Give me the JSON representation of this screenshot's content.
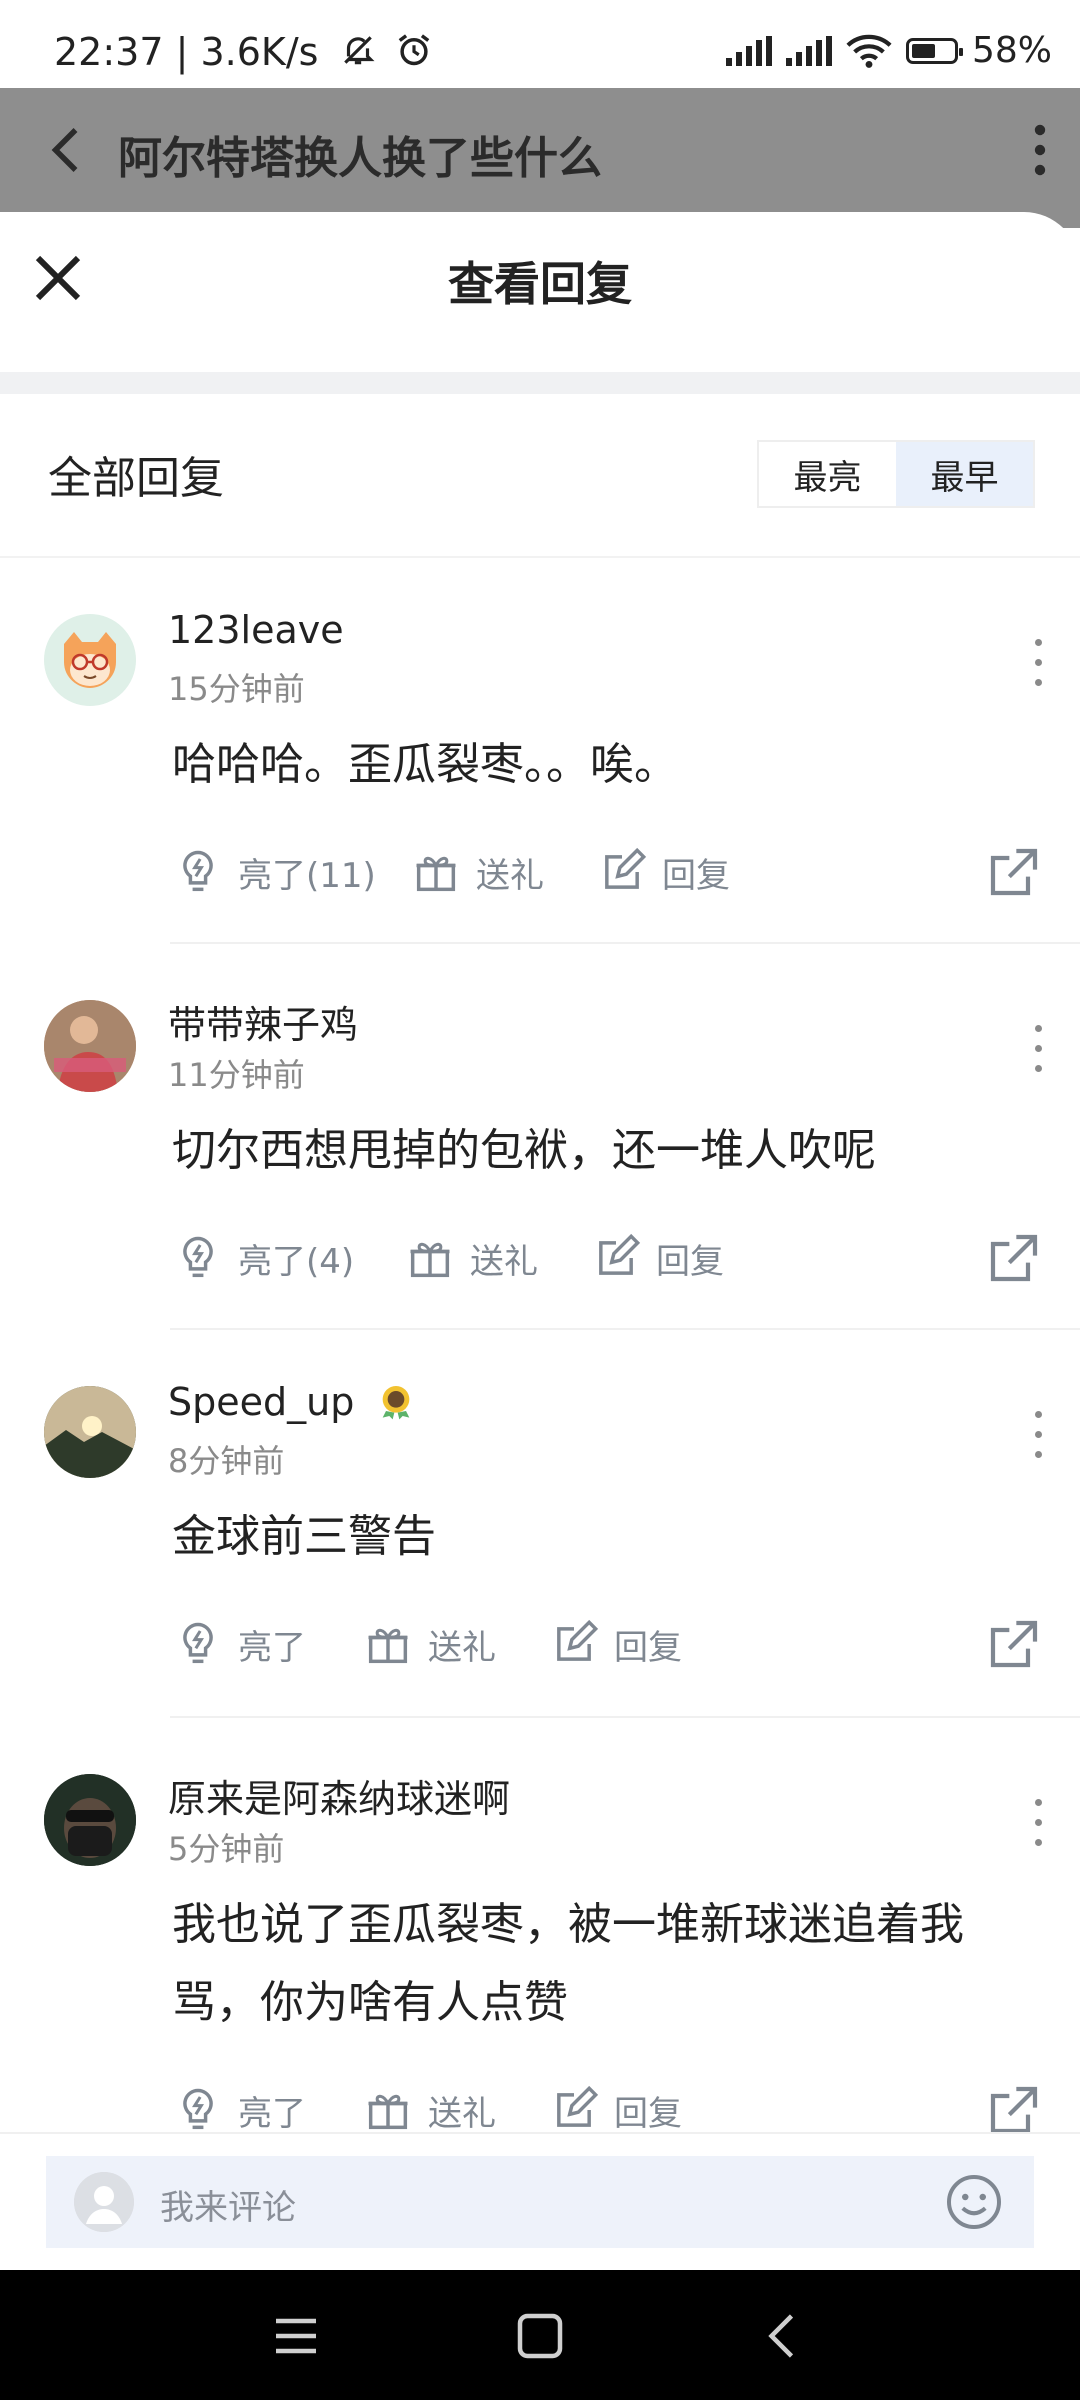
{
  "status_bar": {
    "time": "22:37 | 3.6K/s",
    "battery": "58%",
    "battery_level": 0.58,
    "icons": [
      "mute-bell-icon",
      "alarm-icon",
      "hd-signal-icon",
      "hd-signal-icon",
      "wifi-icon",
      "battery-icon"
    ]
  },
  "background_page": {
    "title": "阿尔特塔换人换了些什么"
  },
  "sheet": {
    "title": "查看回复",
    "section_title": "全部回复",
    "sort_options": [
      "最亮",
      "最早"
    ],
    "sort_active": "最早"
  },
  "comments": [
    {
      "username": "123leave",
      "time": "15分钟前",
      "text": "哈哈哈。歪瓜裂枣。。唉。",
      "like_label": "亮了(11)",
      "gift_label": "送礼",
      "reply_label": "回复"
    },
    {
      "username": "带带辣子鸡",
      "time": "11分钟前",
      "text": "切尔西想甩掉的包袱，还一堆人吹呢",
      "like_label": "亮了(4)",
      "gift_label": "送礼",
      "reply_label": "回复"
    },
    {
      "username": "Speed_up",
      "time": "8分钟前",
      "text": "金球前三警告",
      "like_label": "亮了",
      "gift_label": "送礼",
      "reply_label": "回复"
    },
    {
      "username": "原来是阿森纳球迷啊",
      "time": "5分钟前",
      "text": "我也说了歪瓜裂枣，被一堆新球迷追着我骂，你为啥有人点赞",
      "like_label": "亮了",
      "gift_label": "送礼",
      "reply_label": "回复"
    }
  ],
  "comment_input": {
    "placeholder": "我来评论"
  },
  "colors": {
    "accent_light": "#e9f0fb",
    "text_secondary": "#8a8a8a",
    "overlay": "#8e8e8e"
  }
}
